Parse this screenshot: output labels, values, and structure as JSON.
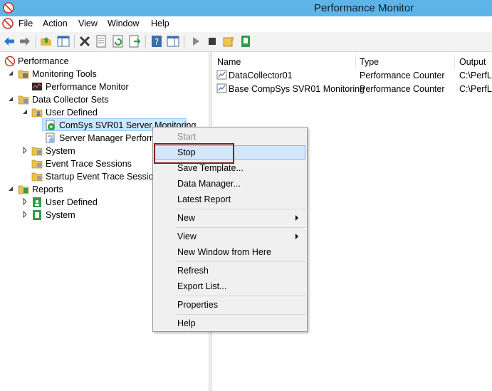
{
  "window": {
    "title": "Performance Monitor"
  },
  "menu": [
    "File",
    "Action",
    "View",
    "Window",
    "Help"
  ],
  "toolbar": {
    "icons": [
      "back-icon",
      "forward-icon",
      "up-folder-icon",
      "show-hide-tree-icon",
      "delete-icon",
      "properties-icon",
      "refresh-icon",
      "export-icon",
      "help-icon",
      "show-action-pane-icon",
      "start-icon",
      "stop-icon",
      "new-icon",
      "report-icon"
    ]
  },
  "tree": {
    "root": "Performance",
    "monitoring_tools": "Monitoring Tools",
    "performance_monitor": "Performance Monitor",
    "data_collector_sets": "Data Collector Sets",
    "user_defined": "User Defined",
    "comsys": "ComSys SVR01 Server Monitoring",
    "server_manager": "Server Manager Performa",
    "system": "System",
    "event_trace": "Event Trace Sessions",
    "startup_event": "Startup Event Trace Sessions",
    "reports": "Reports",
    "reports_user_defined": "User Defined",
    "reports_system": "System"
  },
  "list": {
    "headers": {
      "name": "Name",
      "type": "Type",
      "output": "Output"
    },
    "rows": [
      {
        "name": "DataCollector01",
        "type": "Performance Counter",
        "output": "C:\\PerfLo"
      },
      {
        "name": "Base CompSys SVR01 Monitoring",
        "type": "Performance Counter",
        "output": "C:\\PerfLo"
      }
    ]
  },
  "context_menu": {
    "start": "Start",
    "stop": "Stop",
    "save_template": "Save Template...",
    "data_manager": "Data Manager...",
    "latest_report": "Latest Report",
    "new": "New",
    "view": "View",
    "new_window": "New Window from Here",
    "refresh": "Refresh",
    "export_list": "Export List...",
    "properties": "Properties",
    "help": "Help"
  },
  "colors": {
    "titlebar": "#5cb4e8",
    "highlight_box": "#7d1e25",
    "selection": "#cce8ff"
  }
}
